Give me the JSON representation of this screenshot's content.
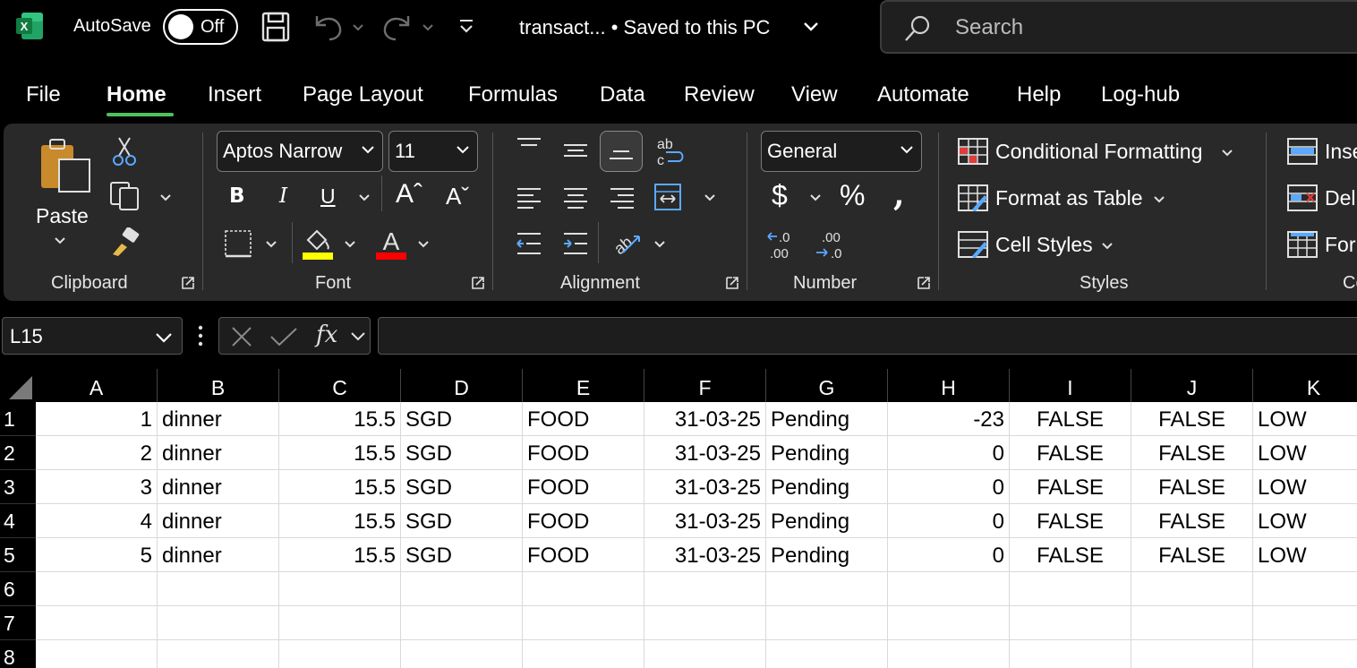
{
  "titlebar": {
    "autosave_label": "AutoSave",
    "autosave_state": "Off",
    "filename": "transact...  • Saved to this PC",
    "search_placeholder": "Search"
  },
  "tabs": [
    "File",
    "Home",
    "Insert",
    "Page Layout",
    "Formulas",
    "Data",
    "Review",
    "View",
    "Automate",
    "Help",
    "Log-hub"
  ],
  "active_tab": "Home",
  "ribbon": {
    "clipboard": {
      "paste_label": "Paste",
      "group_label": "Clipboard"
    },
    "font": {
      "font_name": "Aptos Narrow",
      "font_size": "11",
      "group_label": "Font",
      "highlight_color": "#ffff00",
      "font_color": "#ff0000"
    },
    "alignment": {
      "group_label": "Alignment"
    },
    "number": {
      "format": "General",
      "group_label": "Number"
    },
    "styles": {
      "conditional_formatting": "Conditional Formatting",
      "format_as_table": "Format as Table",
      "cell_styles": "Cell Styles",
      "group_label": "Styles"
    },
    "cells": {
      "insert": "Inse",
      "delete": "Del",
      "format": "For",
      "group_label": "Ce"
    }
  },
  "formula_bar": {
    "name_box": "L15",
    "fx_label": "fx",
    "formula": ""
  },
  "grid": {
    "columns": [
      "A",
      "B",
      "C",
      "D",
      "E",
      "F",
      "G",
      "H",
      "I",
      "J",
      "K"
    ],
    "row_numbers": [
      "1",
      "2",
      "3",
      "4",
      "5",
      "6",
      "7",
      "8"
    ],
    "rows": [
      [
        "1",
        "dinner",
        "15.5",
        "SGD",
        "FOOD",
        "31-03-25",
        "Pending",
        "-23",
        "FALSE",
        "FALSE",
        "LOW"
      ],
      [
        "2",
        "dinner",
        "15.5",
        "SGD",
        "FOOD",
        "31-03-25",
        "Pending",
        "0",
        "FALSE",
        "FALSE",
        "LOW"
      ],
      [
        "3",
        "dinner",
        "15.5",
        "SGD",
        "FOOD",
        "31-03-25",
        "Pending",
        "0",
        "FALSE",
        "FALSE",
        "LOW"
      ],
      [
        "4",
        "dinner",
        "15.5",
        "SGD",
        "FOOD",
        "31-03-25",
        "Pending",
        "0",
        "FALSE",
        "FALSE",
        "LOW"
      ],
      [
        "5",
        "dinner",
        "15.5",
        "SGD",
        "FOOD",
        "31-03-25",
        "Pending",
        "0",
        "FALSE",
        "FALSE",
        "LOW"
      ],
      [
        "",
        "",
        "",
        "",
        "",
        "",
        "",
        "",
        "",
        "",
        ""
      ],
      [
        "",
        "",
        "",
        "",
        "",
        "",
        "",
        "",
        "",
        "",
        ""
      ],
      [
        "",
        "",
        "",
        "",
        "",
        "",
        "",
        "",
        "",
        "",
        ""
      ]
    ]
  }
}
